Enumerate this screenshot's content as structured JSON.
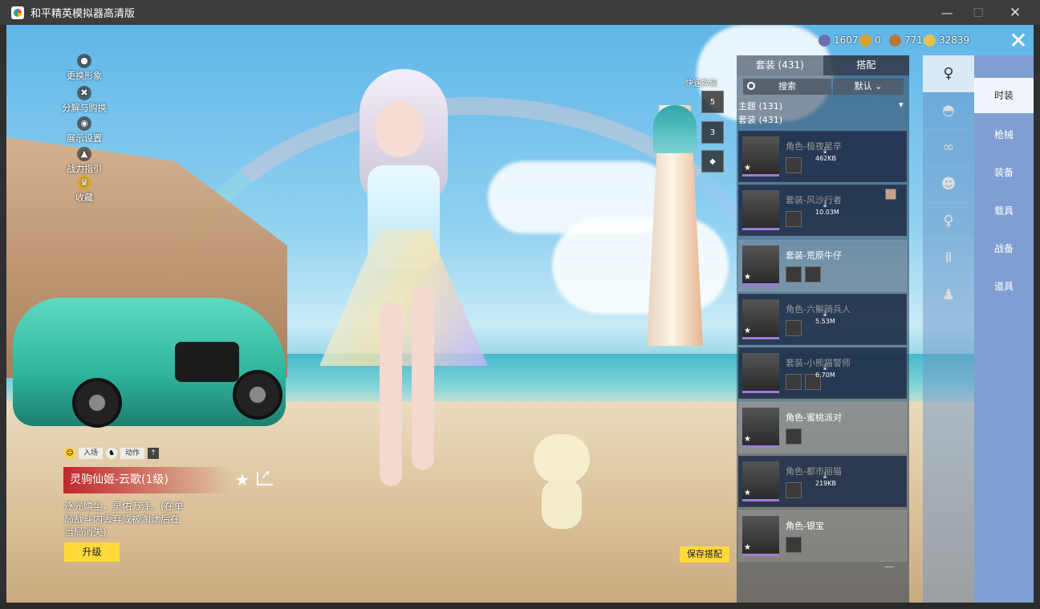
{
  "window": {
    "title": "和平精英模拟器高清版",
    "min": "—",
    "max": "☐",
    "close": "✕"
  },
  "left_menu": [
    "更换形象",
    "分解与购换",
    "展示设置",
    "战力指引",
    "收藏"
  ],
  "currencies": [
    {
      "value": "1607",
      "color": "#6c6fb0"
    },
    {
      "value": "0",
      "color": "#d8a233"
    },
    {
      "value": "771",
      "color": "#b9773a"
    },
    {
      "value": "32839",
      "color": "#e6c24a"
    }
  ],
  "top_close": "✕",
  "quick_switch": {
    "label": "快速换装",
    "slots": [
      "5",
      "3",
      ""
    ]
  },
  "panel": {
    "tabs": [
      "套装 (431)",
      "搭配"
    ],
    "search_placeholder": "搜索",
    "sort": "默认",
    "filters": [
      "主题 (131)",
      "套装 (431)"
    ],
    "items": [
      {
        "name": "角色-极夜星辛",
        "size": "462KB"
      },
      {
        "name": "套装-风沙行者",
        "size": "10.03M"
      },
      {
        "name": "套装-荒原牛仔",
        "size": ""
      },
      {
        "name": "角色-六鬃骑兵人",
        "size": "5.53M"
      },
      {
        "name": "套装-小熊猫警师",
        "size": "6.70M"
      },
      {
        "name": "角色-蜜桃派对",
        "size": ""
      },
      {
        "name": "角色-都市丽猫",
        "size": "219KB"
      },
      {
        "name": "角色-银宝",
        "size": ""
      }
    ],
    "bottom_dash": "—"
  },
  "categories": [
    "时装",
    "枪械",
    "装备",
    "载具",
    "战备",
    "道具"
  ],
  "character": {
    "actions": [
      "入场",
      "动作"
    ],
    "name": "灵驹仙姬-云歌(1级)",
    "description": "逐光嬉尘，灵佑万泽。(在单局战斗内丢弃或被淘汰后在当局消失)",
    "upgrade": "升级",
    "save": "保存搭配"
  }
}
